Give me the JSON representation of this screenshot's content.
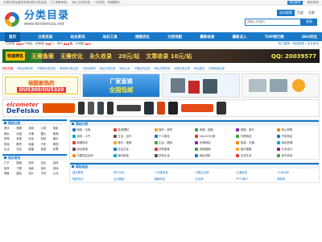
{
  "topbar": {
    "notice": "分类目录免费收录网站的分类目录，人工审核审核，（网上无效标签，一旦发现，将被删除）...",
    "right_items": [
      "网站登录",
      "网站导航"
    ]
  },
  "header": {
    "logo_title": "分类目录",
    "logo_url": "www.fenleimulu.net",
    "search_tabs": [
      "站内搜索",
      "百度",
      "谷歌"
    ],
    "search_placeholder": "请输入关键词",
    "search_button": "搜索"
  },
  "nav": [
    "首页",
    "分类目录",
    "站长资讯",
    "站长工具",
    "搜索优化",
    "分类导航",
    "最新收录",
    "最新点入",
    "TOP排行榜",
    "SEO优化"
  ],
  "stats": {
    "label_sites": "一共收录",
    "sites": "7647",
    "label_pending": "个网站，待审核",
    "pending": "799",
    "label_articles": "个，资讯",
    "articles": "634",
    "label_done": "篇，已审核",
    "done": "507",
    "right": "热门推荐：网站推荐 | 站长资讯"
  },
  "banner1": {
    "badge": "快速排名",
    "texts": [
      "无需备案",
      "无需优化",
      "永久收录",
      "20元/站",
      "文章收录 10元/站"
    ],
    "phone": "QQ: 20039577"
  },
  "links_row": [
    "网站热搜",
    "网站目录收录",
    "万维网分类目录",
    "猫狗网分类目录",
    "分类目录网",
    "网站分类目录",
    "网址大全",
    "中国百科目录",
    "网址分类导航",
    "中国分类目录",
    "网站提交",
    "中国网站目录"
  ],
  "ads": {
    "a_line1": "硅胶耐热的",
    "a_line2": "OU5300/OU5320",
    "b_line1": "厂家直销",
    "b_line2": "全国包邮"
  },
  "banner2": {
    "brand_line1": "elcometer",
    "brand_line2": "DeFelsko"
  },
  "sidebar": {
    "title1": "网站分类",
    "cats": [
      "音乐",
      "视频",
      "游戏",
      "小说",
      "电影",
      "美女",
      "动漫",
      "头像",
      "图片",
      "新闻",
      "体育",
      "军事",
      "社会",
      "科技",
      "娱乐",
      "财经",
      "教育",
      "网盘",
      "汽车",
      "购物",
      "生活",
      "交友",
      "健康",
      "旅游",
      "彩票"
    ],
    "title2": "站长资讯",
    "cats2": [
      "门户",
      "搜索",
      "资讯",
      "论坛",
      "百科",
      "软件",
      "下载",
      "电影",
      "音乐",
      "游戏",
      "博客",
      "建站",
      "设计",
      "书法",
      "公司"
    ]
  },
  "main": {
    "title1": "网站分类",
    "categories": [
      {
        "label": "网络 - 文库",
        "color": "#1a78c8"
      },
      {
        "label": "投资理财",
        "color": "#e53935"
      },
      {
        "label": "娱乐 - 体育",
        "color": "#f5a623"
      },
      {
        "label": "网络 - 搜索",
        "color": "#43a047"
      },
      {
        "label": "视频 - 音乐",
        "color": "#8e24aa"
      },
      {
        "label": "网上购物",
        "color": "#fb8c00"
      },
      {
        "label": "游戏 - 人气",
        "color": "#00acc1"
      },
      {
        "label": "生活 - 出行",
        "color": "#6d4c41"
      },
      {
        "label": "个人网站",
        "color": "#1a78c8"
      },
      {
        "label": "site123分类",
        "color": "#e53935"
      },
      {
        "label": "外贸网站",
        "color": "#43a047"
      },
      {
        "label": "汽车网站",
        "color": "#1a78c8"
      },
      {
        "label": "新闻综合",
        "color": "#e53935"
      },
      {
        "label": "音乐 - 视频",
        "color": "#f5a623"
      },
      {
        "label": "生活 - 服务",
        "color": "#43a047"
      },
      {
        "label": "优秀网站",
        "color": "#8e24aa"
      },
      {
        "label": "旅游 - 交通",
        "color": "#fb8c00"
      },
      {
        "label": "网站资源",
        "color": "#00acc1"
      },
      {
        "label": "综合其他",
        "color": "#6d4c41"
      },
      {
        "label": "社会文化",
        "color": "#1a78c8"
      },
      {
        "label": "体育健身",
        "color": "#e53935"
      },
      {
        "label": "网络营销",
        "color": "#43a047"
      },
      {
        "label": "医疗健康",
        "color": "#f5a623"
      },
      {
        "label": "艺术设计",
        "color": "#8e24aa"
      },
      {
        "label": "中国知名百科",
        "color": "#fb8c00"
      },
      {
        "label": "娱乐影音",
        "color": "#00acc1"
      },
      {
        "label": "学校大全",
        "color": "#6d4c41"
      },
      {
        "label": "网址导航",
        "color": "#1a78c8"
      },
      {
        "label": "文化艺术",
        "color": "#e53935"
      },
      {
        "label": "电子商务",
        "color": "#43a047"
      }
    ],
    "title2": "网站动态",
    "recent": [
      "道文教育",
      "宋中平台",
      "一叫美收录",
      "中国企业网",
      "九道科技",
      "17设计网",
      "搜索优化",
      "企业链接",
      "道家网站",
      "企业网",
      "PPTV客户",
      "导航网"
    ]
  }
}
